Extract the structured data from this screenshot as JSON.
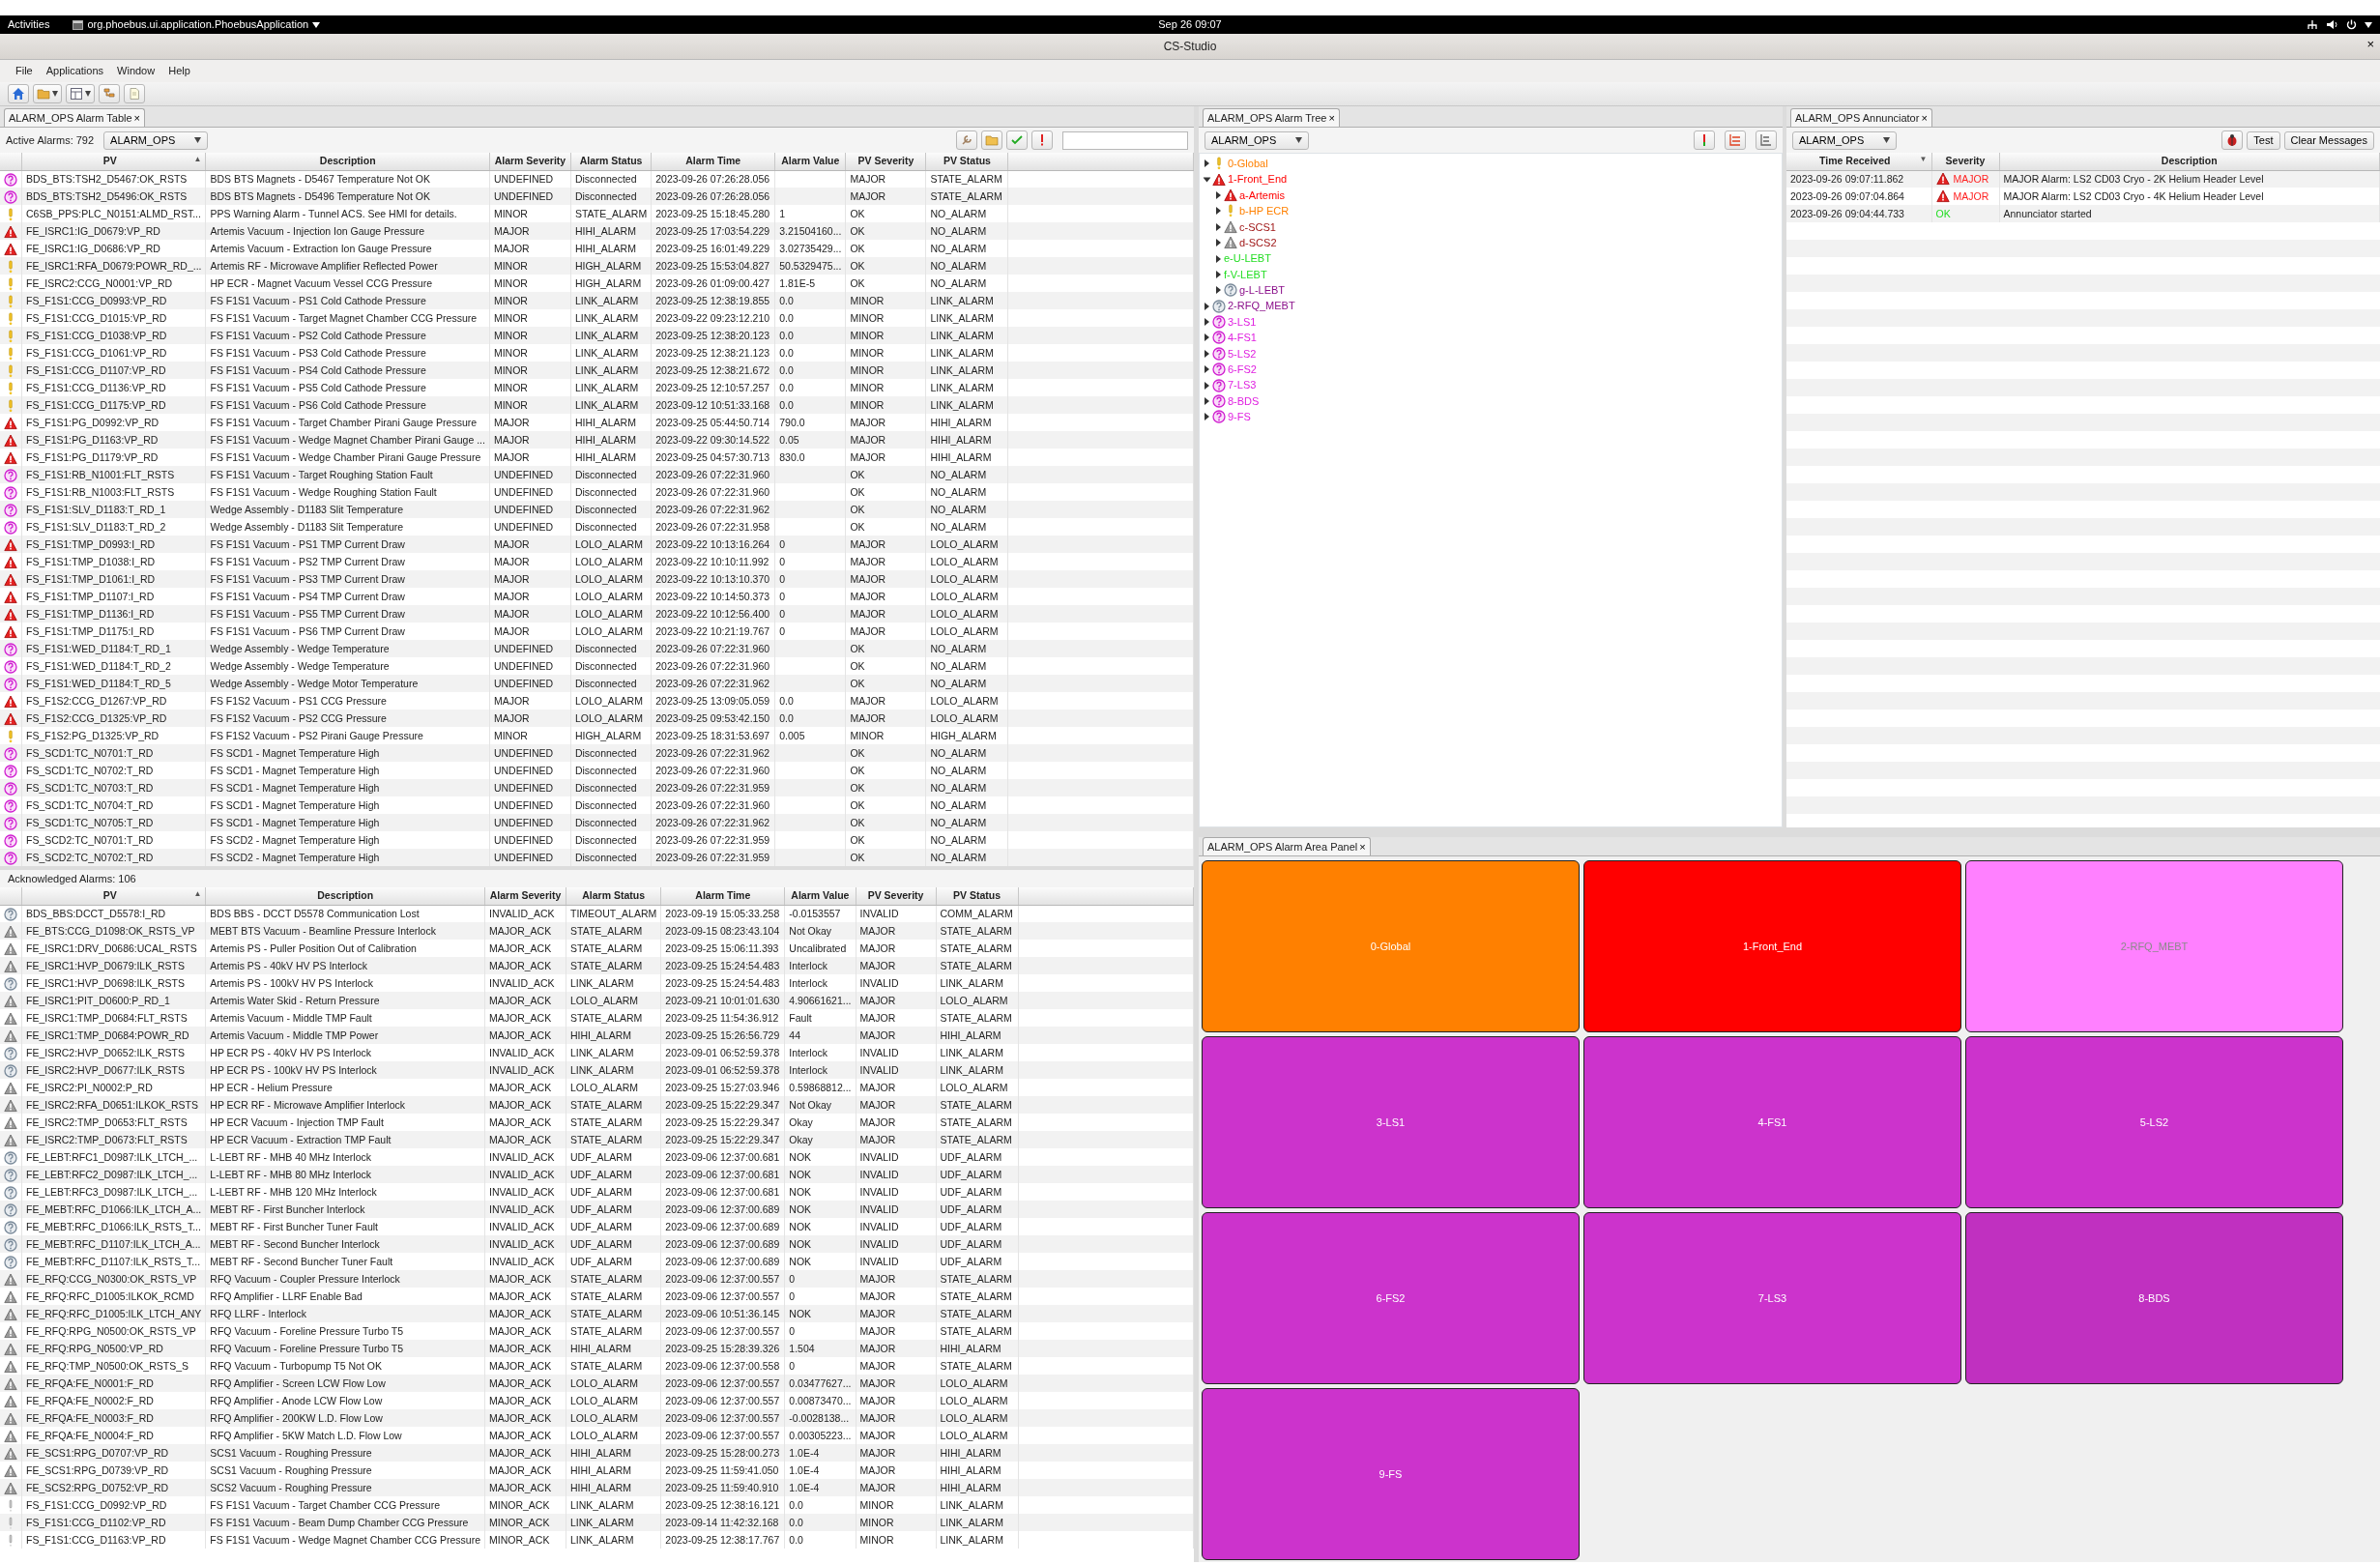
{
  "top_bar": {
    "activities": "Activities",
    "app_menu": "org.phoebus.ui.application.PhoebusApplication",
    "clock": "Sep 26 09:07"
  },
  "window": {
    "title": "CS-Studio",
    "close": "×"
  },
  "menu": [
    "File",
    "Applications",
    "Window",
    "Help"
  ],
  "alarm_table": {
    "tab": {
      "label": "ALARM_OPS Alarm Table",
      "close": "×"
    },
    "active_label": "Active Alarms: 792",
    "config": "ALARM_OPS",
    "active_columns": [
      {
        "label": "PV",
        "sort": "▲"
      },
      {
        "label": "Description"
      },
      {
        "label": "Alarm Severity"
      },
      {
        "label": "Alarm Status"
      },
      {
        "label": "Alarm Time"
      },
      {
        "label": "Alarm Value"
      },
      {
        "label": "PV Severity"
      },
      {
        "label": "PV Status"
      }
    ],
    "active_rows": [
      {
        "kind": "undefined",
        "pv": "BDS_BTS:TSH2_D5467:OK_RSTS",
        "description": "BDS BTS Magnets - D5467 Temperature Not OK",
        "alarm_severity": "UNDEFINED",
        "alarm_status": "Disconnected",
        "alarm_time": "2023-09-26 07:26:28.056",
        "pv_severity": "MAJOR",
        "pv_status": "STATE_ALARM"
      },
      {
        "kind": "undefined",
        "pv": "BDS_BTS:TSH2_D5496:OK_RSTS",
        "description": "BDS BTS Magnets - D5496 Temperature Not OK",
        "alarm_severity": "UNDEFINED",
        "alarm_status": "Disconnected",
        "alarm_time": "2023-09-26 07:26:28.056",
        "pv_severity": "MAJOR",
        "pv_status": "STATE_ALARM"
      },
      {
        "kind": "minor",
        "pv": "C6SB_PPS:PLC_N0151:ALMD_RST...",
        "description": "PPS Warning Alarm - Tunnel ACS. See HMI for details.",
        "alarm_severity": "MINOR",
        "alarm_status": "STATE_ALARM",
        "alarm_time": "2023-09-25 15:18:45.280",
        "alarm_value": "1",
        "pv_severity": "OK",
        "pv_status": "NO_ALARM"
      },
      {
        "kind": "major",
        "pv": "FE_ISRC1:IG_D0679:VP_RD",
        "description": "Artemis Vacuum - Injection Ion Gauge Pressure",
        "alarm_severity": "MAJOR",
        "alarm_status": "HIHI_ALARM",
        "alarm_time": "2023-09-25 17:03:54.229",
        "alarm_value": "3.21504160...",
        "pv_severity": "OK",
        "pv_status": "NO_ALARM"
      },
      {
        "kind": "major",
        "pv": "FE_ISRC1:IG_D0686:VP_RD",
        "description": "Artemis Vacuum - Extraction Ion Gauge Pressure",
        "alarm_severity": "MAJOR",
        "alarm_status": "HIHI_ALARM",
        "alarm_time": "2023-09-25 16:01:49.229",
        "alarm_value": "3.02735429...",
        "pv_severity": "OK",
        "pv_status": "NO_ALARM"
      },
      {
        "kind": "minor",
        "pv": "FE_ISRC1:RFA_D0679:POWR_RD_...",
        "description": "Artemis RF - Microwave Amplifier Reflected Power",
        "alarm_severity": "MINOR",
        "alarm_status": "HIGH_ALARM",
        "alarm_time": "2023-09-25 15:53:04.827",
        "alarm_value": "50.5329475...",
        "pv_severity": "OK",
        "pv_status": "NO_ALARM"
      },
      {
        "kind": "minor",
        "pv": "FE_ISRC2:CCG_N0001:VP_RD",
        "description": "HP ECR - Magnet Vacuum Vessel CCG Pressure",
        "alarm_severity": "MINOR",
        "alarm_status": "HIGH_ALARM",
        "alarm_time": "2023-09-26 01:09:00.427",
        "alarm_value": "1.81E-5",
        "pv_severity": "OK",
        "pv_status": "NO_ALARM"
      },
      {
        "kind": "minor",
        "pv": "FS_F1S1:CCG_D0993:VP_RD",
        "description": "FS F1S1 Vacuum - PS1 Cold Cathode Pressure",
        "alarm_severity": "MINOR",
        "alarm_status": "LINK_ALARM",
        "alarm_time": "2023-09-25 12:38:19.855",
        "alarm_value": "0.0",
        "pv_severity": "MINOR",
        "pv_status": "LINK_ALARM"
      },
      {
        "kind": "minor",
        "pv": "FS_F1S1:CCG_D1015:VP_RD",
        "description": "FS F1S1 Vacuum - Target Magnet Chamber CCG Pressure",
        "alarm_severity": "MINOR",
        "alarm_status": "LINK_ALARM",
        "alarm_time": "2023-09-22 09:23:12.210",
        "alarm_value": "0.0",
        "pv_severity": "MINOR",
        "pv_status": "LINK_ALARM"
      },
      {
        "kind": "minor",
        "pv": "FS_F1S1:CCG_D1038:VP_RD",
        "description": "FS F1S1 Vacuum - PS2 Cold Cathode Pressure",
        "alarm_severity": "MINOR",
        "alarm_status": "LINK_ALARM",
        "alarm_time": "2023-09-25 12:38:20.123",
        "alarm_value": "0.0",
        "pv_severity": "MINOR",
        "pv_status": "LINK_ALARM"
      },
      {
        "kind": "minor",
        "pv": "FS_F1S1:CCG_D1061:VP_RD",
        "description": "FS F1S1 Vacuum - PS3 Cold Cathode Pressure",
        "alarm_severity": "MINOR",
        "alarm_status": "LINK_ALARM",
        "alarm_time": "2023-09-25 12:38:21.123",
        "alarm_value": "0.0",
        "pv_severity": "MINOR",
        "pv_status": "LINK_ALARM"
      },
      {
        "kind": "minor",
        "pv": "FS_F1S1:CCG_D1107:VP_RD",
        "description": "FS F1S1 Vacuum - PS4 Cold Cathode Pressure",
        "alarm_severity": "MINOR",
        "alarm_status": "LINK_ALARM",
        "alarm_time": "2023-09-25 12:38:21.672",
        "alarm_value": "0.0",
        "pv_severity": "MINOR",
        "pv_status": "LINK_ALARM"
      },
      {
        "kind": "minor",
        "pv": "FS_F1S1:CCG_D1136:VP_RD",
        "description": "FS F1S1 Vacuum - PS5 Cold Cathode Pressure",
        "alarm_severity": "MINOR",
        "alarm_status": "LINK_ALARM",
        "alarm_time": "2023-09-25 12:10:57.257",
        "alarm_value": "0.0",
        "pv_severity": "MINOR",
        "pv_status": "LINK_ALARM"
      },
      {
        "kind": "minor",
        "pv": "FS_F1S1:CCG_D1175:VP_RD",
        "description": "FS F1S1 Vacuum - PS6 Cold Cathode Pressure",
        "alarm_severity": "MINOR",
        "alarm_status": "LINK_ALARM",
        "alarm_time": "2023-09-12 10:51:33.168",
        "alarm_value": "0.0",
        "pv_severity": "MINOR",
        "pv_status": "LINK_ALARM"
      },
      {
        "kind": "major",
        "pv": "FS_F1S1:PG_D0992:VP_RD",
        "description": "FS F1S1 Vacuum - Target Chamber Pirani Gauge Pressure",
        "alarm_severity": "MAJOR",
        "alarm_status": "HIHI_ALARM",
        "alarm_time": "2023-09-25 05:44:50.714",
        "alarm_value": "790.0",
        "pv_severity": "MAJOR",
        "pv_status": "HIHI_ALARM"
      },
      {
        "kind": "major",
        "pv": "FS_F1S1:PG_D1163:VP_RD",
        "description": "FS F1S1 Vacuum - Wedge Magnet Chamber Pirani Gauge ...",
        "alarm_severity": "MAJOR",
        "alarm_status": "HIHI_ALARM",
        "alarm_time": "2023-09-22 09:30:14.522",
        "alarm_value": "0.05",
        "pv_severity": "MAJOR",
        "pv_status": "HIHI_ALARM"
      },
      {
        "kind": "major",
        "pv": "FS_F1S1:PG_D1179:VP_RD",
        "description": "FS F1S1 Vacuum - Wedge Chamber Pirani Gauge Pressure",
        "alarm_severity": "MAJOR",
        "alarm_status": "HIHI_ALARM",
        "alarm_time": "2023-09-25 04:57:30.713",
        "alarm_value": "830.0",
        "pv_severity": "MAJOR",
        "pv_status": "HIHI_ALARM"
      },
      {
        "kind": "undefined",
        "pv": "FS_F1S1:RB_N1001:FLT_RSTS",
        "description": "FS F1S1 Vacuum - Target Roughing Station Fault",
        "alarm_severity": "UNDEFINED",
        "alarm_status": "Disconnected",
        "alarm_time": "2023-09-26 07:22:31.960",
        "pv_severity": "OK",
        "pv_status": "NO_ALARM"
      },
      {
        "kind": "undefined",
        "pv": "FS_F1S1:RB_N1003:FLT_RSTS",
        "description": "FS F1S1 Vacuum - Wedge Roughing Station Fault",
        "alarm_severity": "UNDEFINED",
        "alarm_status": "Disconnected",
        "alarm_time": "2023-09-26 07:22:31.960",
        "pv_severity": "OK",
        "pv_status": "NO_ALARM"
      },
      {
        "kind": "undefined",
        "pv": "FS_F1S1:SLV_D1183:T_RD_1",
        "description": "Wedge Assembly - D1183 Slit Temperature",
        "alarm_severity": "UNDEFINED",
        "alarm_status": "Disconnected",
        "alarm_time": "2023-09-26 07:22:31.962",
        "pv_severity": "OK",
        "pv_status": "NO_ALARM"
      },
      {
        "kind": "undefined",
        "pv": "FS_F1S1:SLV_D1183:T_RD_2",
        "description": "Wedge Assembly - D1183 Slit Temperature",
        "alarm_severity": "UNDEFINED",
        "alarm_status": "Disconnected",
        "alarm_time": "2023-09-26 07:22:31.958",
        "pv_severity": "OK",
        "pv_status": "NO_ALARM"
      },
      {
        "kind": "major",
        "pv": "FS_F1S1:TMP_D0993:I_RD",
        "description": "FS F1S1 Vacuum - PS1 TMP Current Draw",
        "alarm_severity": "MAJOR",
        "alarm_status": "LOLO_ALARM",
        "alarm_time": "2023-09-22 10:13:16.264",
        "alarm_value": "0",
        "pv_severity": "MAJOR",
        "pv_status": "LOLO_ALARM"
      },
      {
        "kind": "major",
        "pv": "FS_F1S1:TMP_D1038:I_RD",
        "description": "FS F1S1 Vacuum - PS2 TMP Current Draw",
        "alarm_severity": "MAJOR",
        "alarm_status": "LOLO_ALARM",
        "alarm_time": "2023-09-22 10:10:11.992",
        "alarm_value": "0",
        "pv_severity": "MAJOR",
        "pv_status": "LOLO_ALARM"
      },
      {
        "kind": "major",
        "pv": "FS_F1S1:TMP_D1061:I_RD",
        "description": "FS F1S1 Vacuum - PS3 TMP Current Draw",
        "alarm_severity": "MAJOR",
        "alarm_status": "LOLO_ALARM",
        "alarm_time": "2023-09-22 10:13:10.370",
        "alarm_value": "0",
        "pv_severity": "MAJOR",
        "pv_status": "LOLO_ALARM"
      },
      {
        "kind": "major",
        "pv": "FS_F1S1:TMP_D1107:I_RD",
        "description": "FS F1S1 Vacuum - PS4 TMP Current Draw",
        "alarm_severity": "MAJOR",
        "alarm_status": "LOLO_ALARM",
        "alarm_time": "2023-09-22 10:14:50.373",
        "alarm_value": "0",
        "pv_severity": "MAJOR",
        "pv_status": "LOLO_ALARM"
      },
      {
        "kind": "major",
        "pv": "FS_F1S1:TMP_D1136:I_RD",
        "description": "FS F1S1 Vacuum - PS5 TMP Current Draw",
        "alarm_severity": "MAJOR",
        "alarm_status": "LOLO_ALARM",
        "alarm_time": "2023-09-22 10:12:56.400",
        "alarm_value": "0",
        "pv_severity": "MAJOR",
        "pv_status": "LOLO_ALARM"
      },
      {
        "kind": "major",
        "pv": "FS_F1S1:TMP_D1175:I_RD",
        "description": "FS F1S1 Vacuum - PS6 TMP Current Draw",
        "alarm_severity": "MAJOR",
        "alarm_status": "LOLO_ALARM",
        "alarm_time": "2023-09-22 10:21:19.767",
        "alarm_value": "0",
        "pv_severity": "MAJOR",
        "pv_status": "LOLO_ALARM"
      },
      {
        "kind": "undefined",
        "pv": "FS_F1S1:WED_D1184:T_RD_1",
        "description": "Wedge Assembly - Wedge Temperature",
        "alarm_severity": "UNDEFINED",
        "alarm_status": "Disconnected",
        "alarm_time": "2023-09-26 07:22:31.960",
        "pv_severity": "OK",
        "pv_status": "NO_ALARM"
      },
      {
        "kind": "undefined",
        "pv": "FS_F1S1:WED_D1184:T_RD_2",
        "description": "Wedge Assembly - Wedge Temperature",
        "alarm_severity": "UNDEFINED",
        "alarm_status": "Disconnected",
        "alarm_time": "2023-09-26 07:22:31.960",
        "pv_severity": "OK",
        "pv_status": "NO_ALARM"
      },
      {
        "kind": "undefined",
        "pv": "FS_F1S1:WED_D1184:T_RD_5",
        "description": "Wedge Assembly - Wedge Motor Temperature",
        "alarm_severity": "UNDEFINED",
        "alarm_status": "Disconnected",
        "alarm_time": "2023-09-26 07:22:31.962",
        "pv_severity": "OK",
        "pv_status": "NO_ALARM"
      },
      {
        "kind": "major",
        "pv": "FS_F1S2:CCG_D1267:VP_RD",
        "description": "FS F1S2 Vacuum - PS1 CCG Pressure",
        "alarm_severity": "MAJOR",
        "alarm_status": "LOLO_ALARM",
        "alarm_time": "2023-09-25 13:09:05.059",
        "alarm_value": "0.0",
        "pv_severity": "MAJOR",
        "pv_status": "LOLO_ALARM"
      },
      {
        "kind": "major",
        "pv": "FS_F1S2:CCG_D1325:VP_RD",
        "description": "FS F1S2 Vacuum - PS2 CCG Pressure",
        "alarm_severity": "MAJOR",
        "alarm_status": "LOLO_ALARM",
        "alarm_time": "2023-09-25 09:53:42.150",
        "alarm_value": "0.0",
        "pv_severity": "MAJOR",
        "pv_status": "LOLO_ALARM"
      },
      {
        "kind": "minor",
        "pv": "FS_F1S2:PG_D1325:VP_RD",
        "description": "FS F1S2 Vacuum - PS2 Pirani Gauge Pressure",
        "alarm_severity": "MINOR",
        "alarm_status": "HIGH_ALARM",
        "alarm_time": "2023-09-25 18:31:53.697",
        "alarm_value": "0.005",
        "pv_severity": "MINOR",
        "pv_status": "HIGH_ALARM"
      },
      {
        "kind": "undefined",
        "pv": "FS_SCD1:TC_N0701:T_RD",
        "description": "FS SCD1 - Magnet Temperature High",
        "alarm_severity": "UNDEFINED",
        "alarm_status": "Disconnected",
        "alarm_time": "2023-09-26 07:22:31.962",
        "pv_severity": "OK",
        "pv_status": "NO_ALARM"
      },
      {
        "kind": "undefined",
        "pv": "FS_SCD1:TC_N0702:T_RD",
        "description": "FS SCD1 - Magnet Temperature High",
        "alarm_severity": "UNDEFINED",
        "alarm_status": "Disconnected",
        "alarm_time": "2023-09-26 07:22:31.960",
        "pv_severity": "OK",
        "pv_status": "NO_ALARM"
      },
      {
        "kind": "undefined",
        "pv": "FS_SCD1:TC_N0703:T_RD",
        "description": "FS SCD1 - Magnet Temperature High",
        "alarm_severity": "UNDEFINED",
        "alarm_status": "Disconnected",
        "alarm_time": "2023-09-26 07:22:31.959",
        "pv_severity": "OK",
        "pv_status": "NO_ALARM"
      },
      {
        "kind": "undefined",
        "pv": "FS_SCD1:TC_N0704:T_RD",
        "description": "FS SCD1 - Magnet Temperature High",
        "alarm_severity": "UNDEFINED",
        "alarm_status": "Disconnected",
        "alarm_time": "2023-09-26 07:22:31.960",
        "pv_severity": "OK",
        "pv_status": "NO_ALARM"
      },
      {
        "kind": "undefined",
        "pv": "FS_SCD1:TC_N0705:T_RD",
        "description": "FS SCD1 - Magnet Temperature High",
        "alarm_severity": "UNDEFINED",
        "alarm_status": "Disconnected",
        "alarm_time": "2023-09-26 07:22:31.962",
        "pv_severity": "OK",
        "pv_status": "NO_ALARM"
      },
      {
        "kind": "undefined",
        "pv": "FS_SCD2:TC_N0701:T_RD",
        "description": "FS SCD2 - Magnet Temperature High",
        "alarm_severity": "UNDEFINED",
        "alarm_status": "Disconnected",
        "alarm_time": "2023-09-26 07:22:31.959",
        "pv_severity": "OK",
        "pv_status": "NO_ALARM"
      },
      {
        "kind": "undefined",
        "pv": "FS_SCD2:TC_N0702:T_RD",
        "description": "FS SCD2 - Magnet Temperature High",
        "alarm_severity": "UNDEFINED",
        "alarm_status": "Disconnected",
        "alarm_time": "2023-09-26 07:22:31.959",
        "pv_severity": "OK",
        "pv_status": "NO_ALARM"
      }
    ],
    "acknowledged_label": "Acknowledged Alarms: 106",
    "acknowledged_columns": [
      {
        "label": "PV",
        "sort": "▲"
      },
      {
        "label": "Description"
      },
      {
        "label": "Alarm Severity"
      },
      {
        "label": "Alarm Status"
      },
      {
        "label": "Alarm Time"
      },
      {
        "label": "Alarm Value"
      },
      {
        "label": "PV Severity"
      },
      {
        "label": "PV Status"
      }
    ],
    "acknowledged_rows": [
      {
        "kind": "invalid_ack",
        "pv": "BDS_BBS:DCCT_D5578:I_RD",
        "description": "BDS BBS - DCCT D5578 Communication Lost",
        "alarm_severity": "INVALID_ACK",
        "alarm_status": "TIMEOUT_ALARM",
        "alarm_time": "2023-09-19 15:05:33.258",
        "alarm_value": "-0.0153557",
        "pv_severity": "INVALID",
        "pv_status": "COMM_ALARM"
      },
      {
        "kind": "major_ack",
        "pv": "FE_BTS:CCG_D1098:OK_RSTS_VP",
        "description": "MEBT BTS Vacuum - Beamline Pressure Interlock",
        "alarm_severity": "MAJOR_ACK",
        "alarm_status": "STATE_ALARM",
        "alarm_time": "2023-09-15 08:23:43.104",
        "alarm_value": "Not Okay",
        "pv_severity": "MAJOR",
        "pv_status": "STATE_ALARM"
      },
      {
        "kind": "major_ack",
        "pv": "FE_ISRC1:DRV_D0686:UCAL_RSTS",
        "description": "Artemis PS - Puller Position Out of Calibration",
        "alarm_severity": "MAJOR_ACK",
        "alarm_status": "STATE_ALARM",
        "alarm_time": "2023-09-25 15:06:11.393",
        "alarm_value": "Uncalibrated",
        "pv_severity": "MAJOR",
        "pv_status": "STATE_ALARM"
      },
      {
        "kind": "major_ack",
        "pv": "FE_ISRC1:HVP_D0679:ILK_RSTS",
        "description": "Artemis PS - 40kV HV PS Interlock",
        "alarm_severity": "MAJOR_ACK",
        "alarm_status": "STATE_ALARM",
        "alarm_time": "2023-09-25 15:24:54.483",
        "alarm_value": "Interlock",
        "pv_severity": "MAJOR",
        "pv_status": "STATE_ALARM"
      },
      {
        "kind": "invalid_ack",
        "pv": "FE_ISRC1:HVP_D0698:ILK_RSTS",
        "description": "Artemis PS - 100kV HV PS Interlock",
        "alarm_severity": "INVALID_ACK",
        "alarm_status": "LINK_ALARM",
        "alarm_time": "2023-09-25 15:24:54.483",
        "alarm_value": "Interlock",
        "pv_severity": "INVALID",
        "pv_status": "LINK_ALARM"
      },
      {
        "kind": "major_ack",
        "pv": "FE_ISRC1:PIT_D0600:P_RD_1",
        "description": "Artemis Water Skid - Return Pressure",
        "alarm_severity": "MAJOR_ACK",
        "alarm_status": "LOLO_ALARM",
        "alarm_time": "2023-09-21 10:01:01.630",
        "alarm_value": "4.90661621...",
        "pv_severity": "MAJOR",
        "pv_status": "LOLO_ALARM"
      },
      {
        "kind": "major_ack",
        "pv": "FE_ISRC1:TMP_D0684:FLT_RSTS",
        "description": "Artemis Vacuum - Middle TMP Fault",
        "alarm_severity": "MAJOR_ACK",
        "alarm_status": "STATE_ALARM",
        "alarm_time": "2023-09-25 11:54:36.912",
        "alarm_value": "Fault",
        "pv_severity": "MAJOR",
        "pv_status": "STATE_ALARM"
      },
      {
        "kind": "major_ack",
        "pv": "FE_ISRC1:TMP_D0684:POWR_RD",
        "description": "Artemis Vacuum - Middle TMP Power",
        "alarm_severity": "MAJOR_ACK",
        "alarm_status": "HIHI_ALARM",
        "alarm_time": "2023-09-25 15:26:56.729",
        "alarm_value": "44",
        "pv_severity": "MAJOR",
        "pv_status": "HIHI_ALARM"
      },
      {
        "kind": "invalid_ack",
        "pv": "FE_ISRC2:HVP_D0652:ILK_RSTS",
        "description": "HP ECR PS - 40kV HV PS Interlock",
        "alarm_severity": "INVALID_ACK",
        "alarm_status": "LINK_ALARM",
        "alarm_time": "2023-09-01 06:52:59.378",
        "alarm_value": "Interlock",
        "pv_severity": "INVALID",
        "pv_status": "LINK_ALARM"
      },
      {
        "kind": "invalid_ack",
        "pv": "FE_ISRC2:HVP_D0677:ILK_RSTS",
        "description": "HP ECR PS - 100kV HV PS Interlock",
        "alarm_severity": "INVALID_ACK",
        "alarm_status": "LINK_ALARM",
        "alarm_time": "2023-09-01 06:52:59.378",
        "alarm_value": "Interlock",
        "pv_severity": "INVALID",
        "pv_status": "LINK_ALARM"
      },
      {
        "kind": "major_ack",
        "pv": "FE_ISRC2:PI_N0002:P_RD",
        "description": "HP ECR - Helium Pressure",
        "alarm_severity": "MAJOR_ACK",
        "alarm_status": "LOLO_ALARM",
        "alarm_time": "2023-09-25 15:27:03.946",
        "alarm_value": "0.59868812...",
        "pv_severity": "MAJOR",
        "pv_status": "LOLO_ALARM"
      },
      {
        "kind": "major_ack",
        "pv": "FE_ISRC2:RFA_D0651:ILKOK_RSTS",
        "description": "HP ECR RF - Microwave Amplifier Interlock",
        "alarm_severity": "MAJOR_ACK",
        "alarm_status": "STATE_ALARM",
        "alarm_time": "2023-09-25 15:22:29.347",
        "alarm_value": "Not Okay",
        "pv_severity": "MAJOR",
        "pv_status": "STATE_ALARM"
      },
      {
        "kind": "major_ack",
        "pv": "FE_ISRC2:TMP_D0653:FLT_RSTS",
        "description": "HP ECR Vacuum - Injection TMP Fault",
        "alarm_severity": "MAJOR_ACK",
        "alarm_status": "STATE_ALARM",
        "alarm_time": "2023-09-25 15:22:29.347",
        "alarm_value": "Okay",
        "pv_severity": "MAJOR",
        "pv_status": "STATE_ALARM"
      },
      {
        "kind": "major_ack",
        "pv": "FE_ISRC2:TMP_D0673:FLT_RSTS",
        "description": "HP ECR Vacuum - Extraction TMP Fault",
        "alarm_severity": "MAJOR_ACK",
        "alarm_status": "STATE_ALARM",
        "alarm_time": "2023-09-25 15:22:29.347",
        "alarm_value": "Okay",
        "pv_severity": "MAJOR",
        "pv_status": "STATE_ALARM"
      },
      {
        "kind": "invalid_ack",
        "pv": "FE_LEBT:RFC1_D0987:ILK_LTCH_...",
        "description": "L-LEBT RF - MHB 40 MHz Interlock",
        "alarm_severity": "INVALID_ACK",
        "alarm_status": "UDF_ALARM",
        "alarm_time": "2023-09-06 12:37:00.681",
        "alarm_value": "NOK",
        "pv_severity": "INVALID",
        "pv_status": "UDF_ALARM"
      },
      {
        "kind": "invalid_ack",
        "pv": "FE_LEBT:RFC2_D0987:ILK_LTCH_...",
        "description": "L-LEBT RF - MHB 80 MHz Interlock",
        "alarm_severity": "INVALID_ACK",
        "alarm_status": "UDF_ALARM",
        "alarm_time": "2023-09-06 12:37:00.681",
        "alarm_value": "NOK",
        "pv_severity": "INVALID",
        "pv_status": "UDF_ALARM"
      },
      {
        "kind": "invalid_ack",
        "pv": "FE_LEBT:RFC3_D0987:ILK_LTCH_...",
        "description": "L-LEBT RF - MHB 120 MHz Interlock",
        "alarm_severity": "INVALID_ACK",
        "alarm_status": "UDF_ALARM",
        "alarm_time": "2023-09-06 12:37:00.681",
        "alarm_value": "NOK",
        "pv_severity": "INVALID",
        "pv_status": "UDF_ALARM"
      },
      {
        "kind": "invalid_ack",
        "pv": "FE_MEBT:RFC_D1066:ILK_LTCH_A...",
        "description": "MEBT RF - First Buncher Interlock",
        "alarm_severity": "INVALID_ACK",
        "alarm_status": "UDF_ALARM",
        "alarm_time": "2023-09-06 12:37:00.689",
        "alarm_value": "NOK",
        "pv_severity": "INVALID",
        "pv_status": "UDF_ALARM"
      },
      {
        "kind": "invalid_ack",
        "pv": "FE_MEBT:RFC_D1066:ILK_RSTS_T...",
        "description": "MEBT RF - First Buncher Tuner Fault",
        "alarm_severity": "INVALID_ACK",
        "alarm_status": "UDF_ALARM",
        "alarm_time": "2023-09-06 12:37:00.689",
        "alarm_value": "NOK",
        "pv_severity": "INVALID",
        "pv_status": "UDF_ALARM"
      },
      {
        "kind": "invalid_ack",
        "pv": "FE_MEBT:RFC_D1107:ILK_LTCH_A...",
        "description": "MEBT RF - Second Buncher Interlock",
        "alarm_severity": "INVALID_ACK",
        "alarm_status": "UDF_ALARM",
        "alarm_time": "2023-09-06 12:37:00.689",
        "alarm_value": "NOK",
        "pv_severity": "INVALID",
        "pv_status": "UDF_ALARM"
      },
      {
        "kind": "invalid_ack",
        "pv": "FE_MEBT:RFC_D1107:ILK_RSTS_T...",
        "description": "MEBT RF - Second Buncher Tuner Fault",
        "alarm_severity": "INVALID_ACK",
        "alarm_status": "UDF_ALARM",
        "alarm_time": "2023-09-06 12:37:00.689",
        "alarm_value": "NOK",
        "pv_severity": "INVALID",
        "pv_status": "UDF_ALARM"
      },
      {
        "kind": "major_ack",
        "pv": "FE_RFQ:CCG_N0300:OK_RSTS_VP",
        "description": "RFQ Vacuum - Coupler Pressure Interlock",
        "alarm_severity": "MAJOR_ACK",
        "alarm_status": "STATE_ALARM",
        "alarm_time": "2023-09-06 12:37:00.557",
        "alarm_value": "0",
        "pv_severity": "MAJOR",
        "pv_status": "STATE_ALARM"
      },
      {
        "kind": "major_ack",
        "pv": "FE_RFQ:RFC_D1005:ILKOK_RCMD",
        "description": "RFQ Amplifier - LLRF Enable Bad",
        "alarm_severity": "MAJOR_ACK",
        "alarm_status": "STATE_ALARM",
        "alarm_time": "2023-09-06 12:37:00.557",
        "alarm_value": "0",
        "pv_severity": "MAJOR",
        "pv_status": "STATE_ALARM"
      },
      {
        "kind": "major_ack",
        "pv": "FE_RFQ:RFC_D1005:ILK_LTCH_ANY",
        "description": "RFQ LLRF - Interlock",
        "alarm_severity": "MAJOR_ACK",
        "alarm_status": "STATE_ALARM",
        "alarm_time": "2023-09-06 10:51:36.145",
        "alarm_value": "NOK",
        "pv_severity": "MAJOR",
        "pv_status": "STATE_ALARM"
      },
      {
        "kind": "major_ack",
        "pv": "FE_RFQ:RPG_N0500:OK_RSTS_VP",
        "description": "RFQ Vacuum - Foreline Pressure Turbo T5",
        "alarm_severity": "MAJOR_ACK",
        "alarm_status": "STATE_ALARM",
        "alarm_time": "2023-09-06 12:37:00.557",
        "alarm_value": "0",
        "pv_severity": "MAJOR",
        "pv_status": "STATE_ALARM"
      },
      {
        "kind": "major_ack",
        "pv": "FE_RFQ:RPG_N0500:VP_RD",
        "description": "RFQ Vacuum - Foreline Pressure Turbo T5",
        "alarm_severity": "MAJOR_ACK",
        "alarm_status": "HIHI_ALARM",
        "alarm_time": "2023-09-25 15:28:39.326",
        "alarm_value": "1.504",
        "pv_severity": "MAJOR",
        "pv_status": "HIHI_ALARM"
      },
      {
        "kind": "major_ack",
        "pv": "FE_RFQ:TMP_N0500:OK_RSTS_S",
        "description": "RFQ Vacuum - Turbopump T5 Not OK",
        "alarm_severity": "MAJOR_ACK",
        "alarm_status": "STATE_ALARM",
        "alarm_time": "2023-09-06 12:37:00.558",
        "alarm_value": "0",
        "pv_severity": "MAJOR",
        "pv_status": "STATE_ALARM"
      },
      {
        "kind": "major_ack",
        "pv": "FE_RFQA:FE_N0001:F_RD",
        "description": "RFQ Amplifier - Screen LCW Flow Low",
        "alarm_severity": "MAJOR_ACK",
        "alarm_status": "LOLO_ALARM",
        "alarm_time": "2023-09-06 12:37:00.557",
        "alarm_value": "0.03477627...",
        "pv_severity": "MAJOR",
        "pv_status": "LOLO_ALARM"
      },
      {
        "kind": "major_ack",
        "pv": "FE_RFQA:FE_N0002:F_RD",
        "description": "RFQ Amplifier - Anode LCW Flow Low",
        "alarm_severity": "MAJOR_ACK",
        "alarm_status": "LOLO_ALARM",
        "alarm_time": "2023-09-06 12:37:00.557",
        "alarm_value": "0.00873470...",
        "pv_severity": "MAJOR",
        "pv_status": "LOLO_ALARM"
      },
      {
        "kind": "major_ack",
        "pv": "FE_RFQA:FE_N0003:F_RD",
        "description": "RFQ Amplifier - 200KW L.D. Flow Low",
        "alarm_severity": "MAJOR_ACK",
        "alarm_status": "LOLO_ALARM",
        "alarm_time": "2023-09-06 12:37:00.557",
        "alarm_value": "-0.0028138...",
        "pv_severity": "MAJOR",
        "pv_status": "LOLO_ALARM"
      },
      {
        "kind": "major_ack",
        "pv": "FE_RFQA:FE_N0004:F_RD",
        "description": "RFQ Amplifier - 5KW Match L.D. Flow Low",
        "alarm_severity": "MAJOR_ACK",
        "alarm_status": "LOLO_ALARM",
        "alarm_time": "2023-09-06 12:37:00.557",
        "alarm_value": "0.00305223...",
        "pv_severity": "MAJOR",
        "pv_status": "LOLO_ALARM"
      },
      {
        "kind": "major_ack",
        "pv": "FE_SCS1:RPG_D0707:VP_RD",
        "description": "SCS1 Vacuum - Roughing Pressure",
        "alarm_severity": "MAJOR_ACK",
        "alarm_status": "HIHI_ALARM",
        "alarm_time": "2023-09-25 15:28:00.273",
        "alarm_value": "1.0E-4",
        "pv_severity": "MAJOR",
        "pv_status": "HIHI_ALARM"
      },
      {
        "kind": "major_ack",
        "pv": "FE_SCS1:RPG_D0739:VP_RD",
        "description": "SCS1 Vacuum - Roughing Pressure",
        "alarm_severity": "MAJOR_ACK",
        "alarm_status": "HIHI_ALARM",
        "alarm_time": "2023-09-25 11:59:41.050",
        "alarm_value": "1.0E-4",
        "pv_severity": "MAJOR",
        "pv_status": "HIHI_ALARM"
      },
      {
        "kind": "major_ack",
        "pv": "FE_SCS2:RPG_D0752:VP_RD",
        "description": "SCS2 Vacuum - Roughing Pressure",
        "alarm_severity": "MAJOR_ACK",
        "alarm_status": "HIHI_ALARM",
        "alarm_time": "2023-09-25 11:59:40.910",
        "alarm_value": "1.0E-4",
        "pv_severity": "MAJOR",
        "pv_status": "HIHI_ALARM"
      },
      {
        "kind": "minor_ack",
        "pv": "FS_F1S1:CCG_D0992:VP_RD",
        "description": "FS F1S1 Vacuum - Target Chamber CCG Pressure",
        "alarm_severity": "MINOR_ACK",
        "alarm_status": "LINK_ALARM",
        "alarm_time": "2023-09-25 12:38:16.121",
        "alarm_value": "0.0",
        "pv_severity": "MINOR",
        "pv_status": "LINK_ALARM"
      },
      {
        "kind": "minor_ack",
        "pv": "FS_F1S1:CCG_D1102:VP_RD",
        "description": "FS F1S1 Vacuum - Beam Dump Chamber CCG Pressure",
        "alarm_severity": "MINOR_ACK",
        "alarm_status": "LINK_ALARM",
        "alarm_time": "2023-09-14 11:42:32.168",
        "alarm_value": "0.0",
        "pv_severity": "MINOR",
        "pv_status": "LINK_ALARM"
      },
      {
        "kind": "minor_ack",
        "pv": "FS_F1S1:CCG_D1163:VP_RD",
        "description": "FS F1S1 Vacuum - Wedge Magnet Chamber CCG Pressure",
        "alarm_severity": "MINOR_ACK",
        "alarm_status": "LINK_ALARM",
        "alarm_time": "2023-09-25 12:38:17.767",
        "alarm_value": "0.0",
        "pv_severity": "MINOR",
        "pv_status": "LINK_ALARM"
      }
    ]
  },
  "alarm_tree": {
    "tab": {
      "label": "ALARM_OPS Alarm Tree",
      "close": "×"
    },
    "config": "ALARM_OPS",
    "items": [
      {
        "label": "0-Global",
        "kind": "minor",
        "color": "#ff8000",
        "expanded": false
      },
      {
        "label": "1-Front_End",
        "kind": "major",
        "color": "#ff0000",
        "expanded": true,
        "children": [
          {
            "label": "a-Artemis",
            "kind": "major",
            "color": "#ff0000",
            "expanded": false
          },
          {
            "label": "b-HP ECR",
            "kind": "minor",
            "color": "#ff8000",
            "expanded": false
          },
          {
            "label": "c-SCS1",
            "kind": "major_ack",
            "color": "#a01818",
            "expanded": false
          },
          {
            "label": "d-SCS2",
            "kind": "major_ack",
            "color": "#a01818",
            "expanded": false
          },
          {
            "label": "e-U-LEBT",
            "kind": "ok",
            "color": "#22dd22",
            "expanded": false
          },
          {
            "label": "f-V-LEBT",
            "kind": "ok",
            "color": "#22dd22",
            "expanded": false
          },
          {
            "label": "g-L-LEBT",
            "kind": "invalid_ack",
            "color": "#8b108b",
            "expanded": false
          }
        ]
      },
      {
        "label": "2-RFQ_MEBT",
        "kind": "invalid_ack",
        "color": "#8b108b",
        "expanded": false
      },
      {
        "label": "3-LS1",
        "kind": "undefined",
        "color": "#e020e0",
        "expanded": false
      },
      {
        "label": "4-FS1",
        "kind": "undefined",
        "color": "#e020e0",
        "expanded": false
      },
      {
        "label": "5-LS2",
        "kind": "undefined",
        "color": "#e020e0",
        "expanded": false
      },
      {
        "label": "6-FS2",
        "kind": "undefined",
        "color": "#e020e0",
        "expanded": false
      },
      {
        "label": "7-LS3",
        "kind": "undefined",
        "color": "#e020e0",
        "expanded": false
      },
      {
        "label": "8-BDS",
        "kind": "undefined",
        "color": "#e020e0",
        "expanded": false
      },
      {
        "label": "9-FS",
        "kind": "undefined",
        "color": "#e020e0",
        "expanded": false
      }
    ]
  },
  "annunciator": {
    "tab": {
      "label": "ALARM_OPS Annunciator",
      "close": "×"
    },
    "config": "ALARM_OPS",
    "buttons": [
      "Test",
      "Clear Messages"
    ],
    "columns": [
      {
        "label": "Time Received",
        "sort": "▼"
      },
      {
        "label": "Severity"
      },
      {
        "label": "Description"
      }
    ],
    "rows": [
      {
        "time": "2023-09-26 09:07:11.862",
        "kind": "major",
        "severity": "MAJOR",
        "color": "#ff2020",
        "description": "MAJOR Alarm: LS2 CD03 Cryo - 2K Helium Header Level"
      },
      {
        "time": "2023-09-26 09:07:04.864",
        "kind": "major",
        "severity": "MAJOR",
        "color": "#ff2020",
        "description": "MAJOR Alarm: LS2 CD03 Cryo - 4K Helium Header Level"
      },
      {
        "time": "2023-09-26 09:04:44.733",
        "kind": "ok",
        "severity": "OK",
        "color": "#22dd22",
        "description": "Annunciator started"
      }
    ]
  },
  "area_panel": {
    "tab": {
      "label": "ALARM_OPS Alarm Area Panel",
      "close": "×"
    },
    "tiles": [
      {
        "label": "0-Global",
        "color": "#ff8000"
      },
      {
        "label": "1-Front_End",
        "color": "#ff0000"
      },
      {
        "label": "2-RFQ_MEBT",
        "color": "#ff80ff"
      },
      {
        "label": "3-LS1",
        "color": "#cc33cc"
      },
      {
        "label": "4-FS1",
        "color": "#cc33cc"
      },
      {
        "label": "5-LS2",
        "color": "#cc33cc"
      },
      {
        "label": "6-FS2",
        "color": "#cc33cc"
      },
      {
        "label": "7-LS3",
        "color": "#cc33cc"
      },
      {
        "label": "8-BDS",
        "color": "#c030c0"
      },
      {
        "label": "9-FS",
        "color": "#cc33cc"
      }
    ]
  }
}
